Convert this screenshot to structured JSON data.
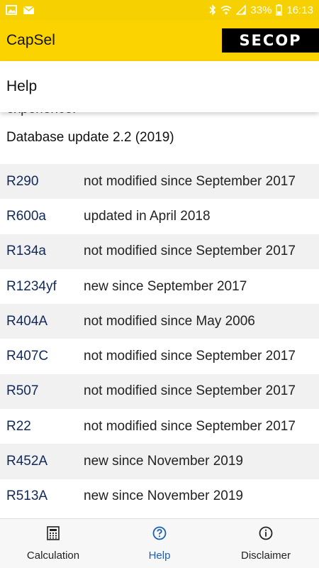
{
  "statusbar": {
    "battery": "33%",
    "time": "16:13",
    "icons": [
      "image-icon",
      "mail-icon",
      "bluetooth-icon",
      "wifi-icon",
      "signal-icon",
      "battery-icon"
    ]
  },
  "appbar": {
    "title": "CapSel",
    "brand": "SECOP"
  },
  "page": {
    "title": "Help"
  },
  "content": {
    "partial_text": "experience.",
    "db_update": "Database update 2.2 (2019)",
    "refrigerants": [
      {
        "name": "R290",
        "status": "not modified since September 2017"
      },
      {
        "name": "R600a",
        "status": "updated in April 2018"
      },
      {
        "name": "R134a",
        "status": "not modified since September 2017"
      },
      {
        "name": "R1234yf",
        "status": "new since September 2017"
      },
      {
        "name": "R404A",
        "status": "not modified since May 2006"
      },
      {
        "name": "R407C",
        "status": "not modified since September 2017"
      },
      {
        "name": "R507",
        "status": "not modified since September 2017"
      },
      {
        "name": "R22",
        "status": "not modified since September 2017"
      },
      {
        "name": "R452A",
        "status": "new since November 2019"
      },
      {
        "name": "R513A",
        "status": "new since November 2019"
      }
    ]
  },
  "bottomnav": {
    "items": [
      {
        "label": "Calculation",
        "icon": "calculator-icon",
        "active": false
      },
      {
        "label": "Help",
        "icon": "help-circle-icon",
        "active": true
      },
      {
        "label": "Disclaimer",
        "icon": "info-circle-icon",
        "active": false
      }
    ]
  },
  "colors": {
    "brand_yellow": "#fbd400",
    "active_blue": "#1a5fb4",
    "row_stripe": "#f1f1f1"
  }
}
